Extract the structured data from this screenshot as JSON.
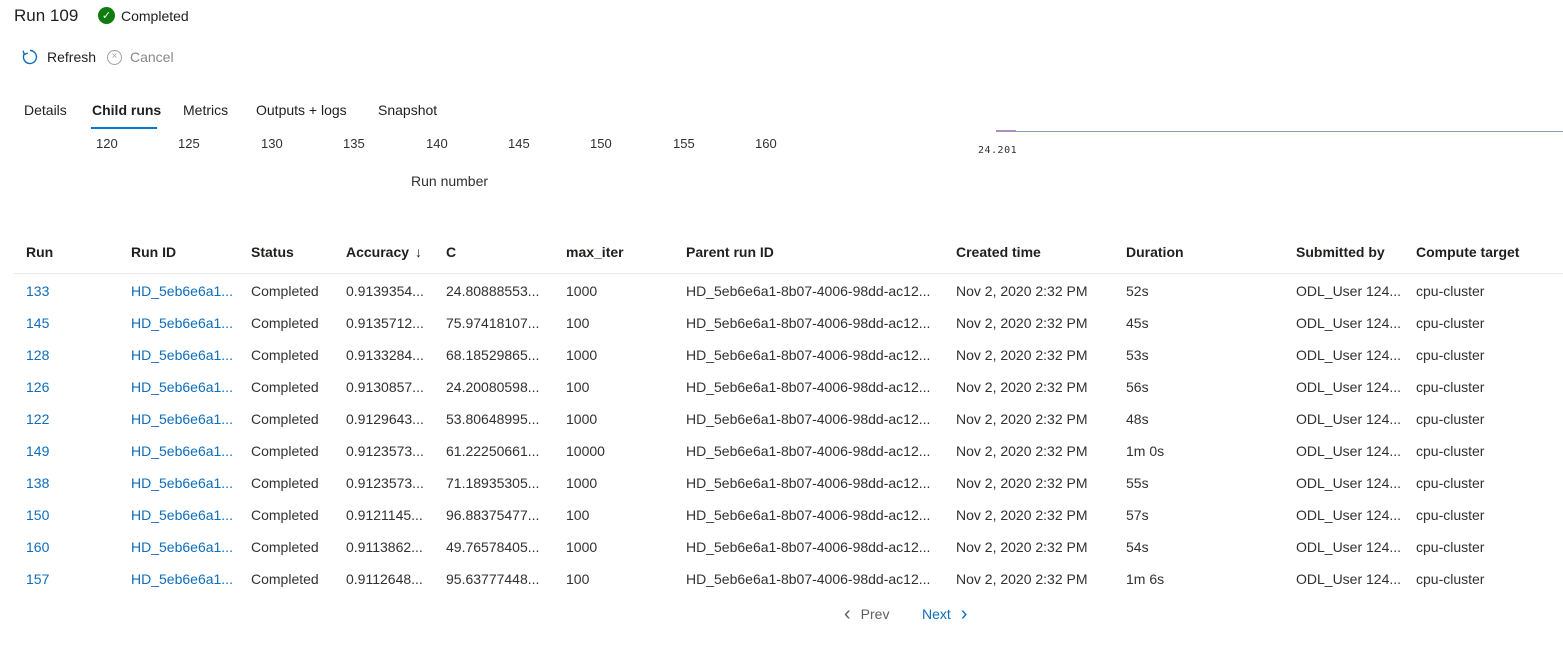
{
  "header": {
    "title": "Run 109",
    "status": "Completed",
    "status_color": "#107c10"
  },
  "commands": {
    "refresh": "Refresh",
    "cancel": "Cancel"
  },
  "tabs": [
    {
      "label": "Details",
      "active": false
    },
    {
      "label": "Child runs",
      "active": true
    },
    {
      "label": "Metrics",
      "active": false
    },
    {
      "label": "Outputs + logs",
      "active": false
    },
    {
      "label": "Snapshot",
      "active": false
    }
  ],
  "chart_data": [
    {
      "type": "scatter",
      "title": "",
      "xlabel": "Run number",
      "ylabel": "",
      "xticks": [
        "120",
        "125",
        "130",
        "135",
        "140",
        "145",
        "150",
        "155",
        "160"
      ],
      "note": ""
    },
    {
      "type": "line",
      "title": "",
      "xticks": [
        "24.201"
      ]
    }
  ],
  "table": {
    "columns": [
      "Run",
      "Run ID",
      "Status",
      "Accuracy",
      "C",
      "max_iter",
      "Parent run ID",
      "Created time",
      "Duration",
      "Submitted by",
      "Compute target"
    ],
    "sort_indicator": "↓",
    "rows": [
      [
        "133",
        "HD_5eb6e6a1...",
        "Completed",
        "0.9139354...",
        "24.80888553...",
        "1000",
        "HD_5eb6e6a1-8b07-4006-98dd-ac12...",
        "Nov 2, 2020 2:32 PM",
        "52s",
        "ODL_User 124...",
        "cpu-cluster"
      ],
      [
        "145",
        "HD_5eb6e6a1...",
        "Completed",
        "0.9135712...",
        "75.97418107...",
        "100",
        "HD_5eb6e6a1-8b07-4006-98dd-ac12...",
        "Nov 2, 2020 2:32 PM",
        "45s",
        "ODL_User 124...",
        "cpu-cluster"
      ],
      [
        "128",
        "HD_5eb6e6a1...",
        "Completed",
        "0.9133284...",
        "68.18529865...",
        "1000",
        "HD_5eb6e6a1-8b07-4006-98dd-ac12...",
        "Nov 2, 2020 2:32 PM",
        "53s",
        "ODL_User 124...",
        "cpu-cluster"
      ],
      [
        "126",
        "HD_5eb6e6a1...",
        "Completed",
        "0.9130857...",
        "24.20080598...",
        "100",
        "HD_5eb6e6a1-8b07-4006-98dd-ac12...",
        "Nov 2, 2020 2:32 PM",
        "56s",
        "ODL_User 124...",
        "cpu-cluster"
      ],
      [
        "122",
        "HD_5eb6e6a1...",
        "Completed",
        "0.9129643...",
        "53.80648995...",
        "1000",
        "HD_5eb6e6a1-8b07-4006-98dd-ac12...",
        "Nov 2, 2020 2:32 PM",
        "48s",
        "ODL_User 124...",
        "cpu-cluster"
      ],
      [
        "149",
        "HD_5eb6e6a1...",
        "Completed",
        "0.9123573...",
        "61.22250661...",
        "10000",
        "HD_5eb6e6a1-8b07-4006-98dd-ac12...",
        "Nov 2, 2020 2:32 PM",
        "1m 0s",
        "ODL_User 124...",
        "cpu-cluster"
      ],
      [
        "138",
        "HD_5eb6e6a1...",
        "Completed",
        "0.9123573...",
        "71.18935305...",
        "1000",
        "HD_5eb6e6a1-8b07-4006-98dd-ac12...",
        "Nov 2, 2020 2:32 PM",
        "55s",
        "ODL_User 124...",
        "cpu-cluster"
      ],
      [
        "150",
        "HD_5eb6e6a1...",
        "Completed",
        "0.9121145...",
        "96.88375477...",
        "100",
        "HD_5eb6e6a1-8b07-4006-98dd-ac12...",
        "Nov 2, 2020 2:32 PM",
        "57s",
        "ODL_User 124...",
        "cpu-cluster"
      ],
      [
        "160",
        "HD_5eb6e6a1...",
        "Completed",
        "0.9113862...",
        "49.76578405...",
        "1000",
        "HD_5eb6e6a1-8b07-4006-98dd-ac12...",
        "Nov 2, 2020 2:32 PM",
        "54s",
        "ODL_User 124...",
        "cpu-cluster"
      ],
      [
        "157",
        "HD_5eb6e6a1...",
        "Completed",
        "0.9112648...",
        "95.63777448...",
        "100",
        "HD_5eb6e6a1-8b07-4006-98dd-ac12...",
        "Nov 2, 2020 2:32 PM",
        "1m 6s",
        "ODL_User 124...",
        "cpu-cluster"
      ]
    ]
  },
  "pager": {
    "prev": "Prev",
    "next": "Next"
  }
}
